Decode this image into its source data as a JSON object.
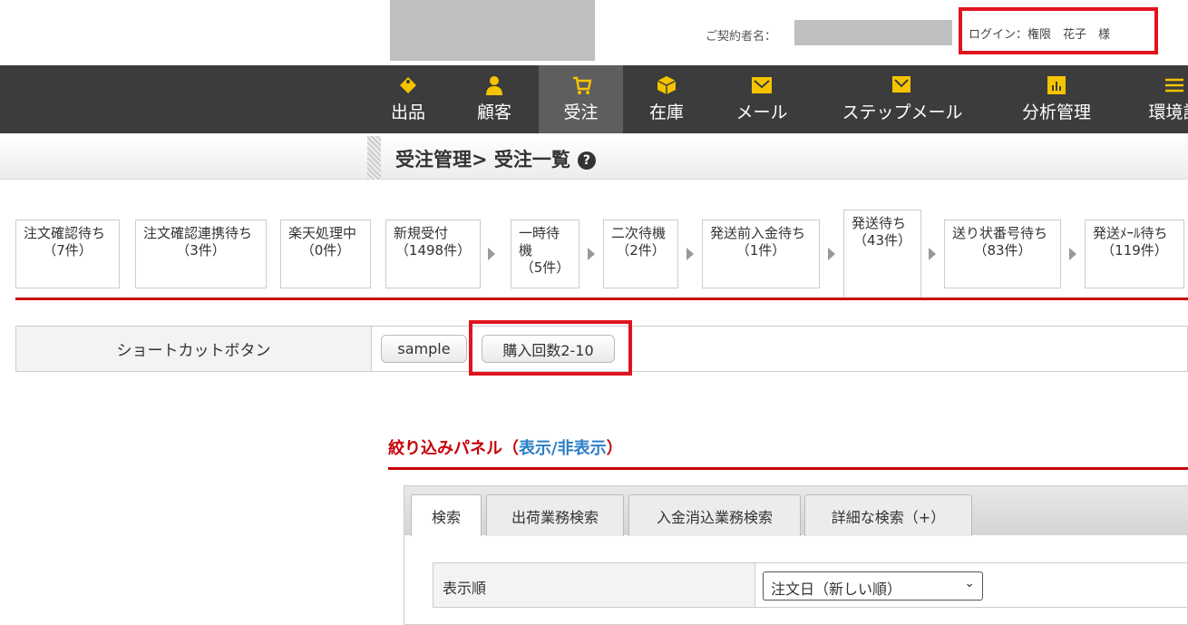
{
  "header": {
    "contract_label": "ご契約者名：",
    "login_text": "ログイン：権限　花子　様"
  },
  "nav": [
    {
      "label": "出品",
      "icon": "tag-icon"
    },
    {
      "label": "顧客",
      "icon": "user-icon"
    },
    {
      "label": "受注",
      "icon": "cart-icon"
    },
    {
      "label": "在庫",
      "icon": "box-icon"
    },
    {
      "label": "メール",
      "icon": "mail-icon"
    },
    {
      "label": "ステップメール",
      "icon": "step-mail-icon"
    },
    {
      "label": "分析管理",
      "icon": "chart-icon"
    },
    {
      "label": "環境設",
      "icon": "settings-icon"
    }
  ],
  "page_title": "受注管理> 受注一覧",
  "statuses": [
    {
      "label": "注文確認待ち",
      "count": "（7件）"
    },
    {
      "label": "注文確認連携待ち",
      "count": "（3件）"
    },
    {
      "label": "楽天処理中",
      "count": "（0件）"
    },
    {
      "label": "新規受付",
      "count": "（1498件）"
    },
    {
      "label": "一時待機",
      "count": "（5件）"
    },
    {
      "label": "二次待機",
      "count": "（2件）"
    },
    {
      "label": "発送前入金待ち",
      "count": "（1件）"
    },
    {
      "label": "発送待ち",
      "count": "（43件）"
    },
    {
      "label": "送り状番号待ち",
      "count": "（83件）"
    },
    {
      "label": "発送ﾒｰﾙ待ち",
      "count": "（119件）"
    }
  ],
  "shortcut": {
    "label": "ショートカットボタン",
    "buttons": [
      "sample",
      "購入回数2-10"
    ]
  },
  "filter": {
    "title": "絞り込みパネル（",
    "toggle": "表示/非表示",
    "close": "）"
  },
  "tabs": [
    "検索",
    "出荷業務検索",
    "入金消込業務検索",
    "詳細な検索（+）"
  ],
  "sort": {
    "label": "表示順",
    "value": "注文日（新しい順）"
  },
  "colors": {
    "accent": "#c8000a",
    "highlight": "#e0141e",
    "nav_bg": "#3c3c3c",
    "icon": "#f5c400"
  }
}
